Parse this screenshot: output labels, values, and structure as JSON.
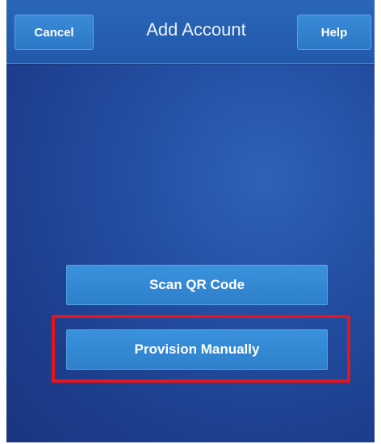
{
  "header": {
    "title": "Add Account",
    "cancel_label": "Cancel",
    "help_label": "Help"
  },
  "main": {
    "scan_label": "Scan QR Code",
    "provision_label": "Provision Manually"
  },
  "colors": {
    "background": "#2450a3",
    "button": "#3386d2",
    "highlight": "#e8141c"
  }
}
